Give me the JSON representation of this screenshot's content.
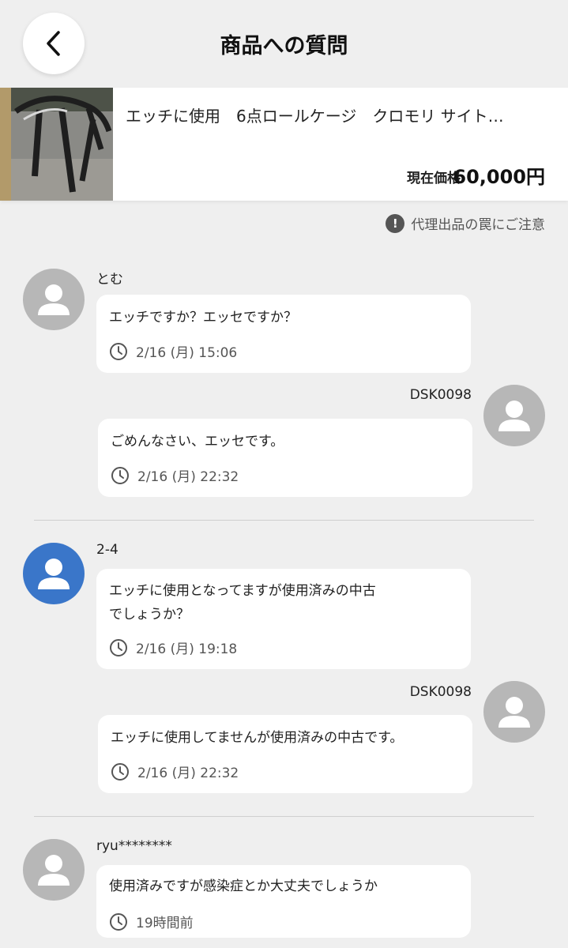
{
  "header": {
    "title": "商品への質問"
  },
  "product": {
    "title": "エッチに使用　6点ロールケージ　クロモリ サイト…",
    "price_label": "現在価格",
    "price_value": "60,000円"
  },
  "notice": {
    "text": "代理出品の罠にご注意"
  },
  "threads": [
    {
      "question": {
        "user": "とむ",
        "text": "エッチですか？エッセですか？",
        "time": "2/16 (月) 15:06"
      },
      "answer": {
        "user": "DSK0098",
        "text": "ごめんなさい、エッセです。",
        "time": "2/16 (月) 22:32"
      }
    },
    {
      "question": {
        "user": "2-4",
        "text": "エッチに使用となってますが使用済みの中古\nでしょうか？",
        "time": "2/16 (月) 19:18"
      },
      "answer": {
        "user": "DSK0098",
        "text": "エッチに使用してませんが使用済みの中古です。",
        "time": "2/16 (月) 22:32"
      }
    },
    {
      "question": {
        "user": "ryu********",
        "text": "使用済みですが感染症とか大丈夫でしょうか",
        "time": "19時間前"
      }
    }
  ],
  "colors": {
    "background": "#efefef",
    "avatar_gray": "#b7b7b7",
    "avatar_blue": "#3a76c9"
  }
}
